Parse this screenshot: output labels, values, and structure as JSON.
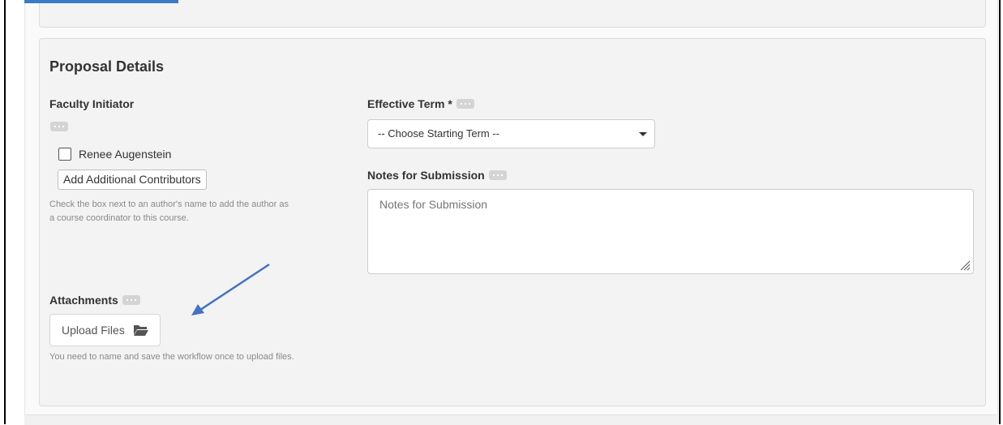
{
  "section_title": "Proposal Details",
  "faculty_initiator": {
    "label": "Faculty Initiator",
    "info_icon": "ellipsis-icon",
    "author_name": "Renee Augenstein",
    "author_checked": false,
    "add_contributors_label": "Add Additional Contributors",
    "help_line_1": "Check the box next to an author's name to add the author as",
    "help_line_2": "a course coordinator to this course."
  },
  "effective_term": {
    "label": "Effective Term *",
    "selected": "-- Choose Starting Term --"
  },
  "notes": {
    "label": "Notes for Submission",
    "placeholder": "Notes for Submission",
    "value": ""
  },
  "attachments": {
    "label": "Attachments",
    "upload_label": "Upload Files",
    "upload_icon": "folder-open-icon",
    "help": "You need to name and save the workflow once to upload files."
  },
  "colors": {
    "accent": "#3a7bc8",
    "annotation_arrow": "#4472c4",
    "panel_bg": "#f3f3f3"
  }
}
